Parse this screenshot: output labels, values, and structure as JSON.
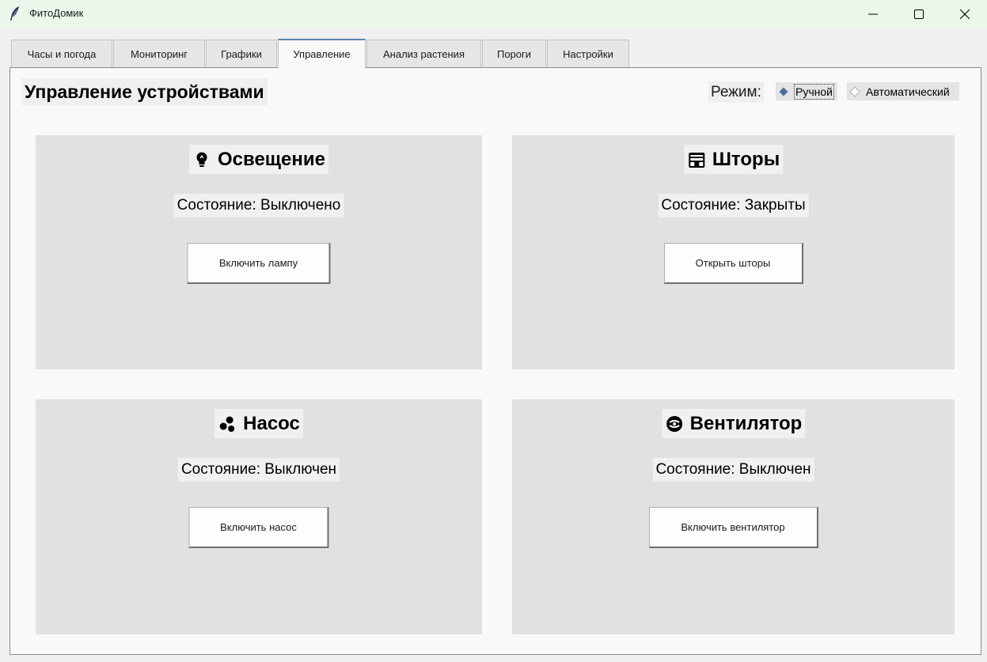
{
  "window": {
    "title": "ФитоДомик",
    "icon": "feather-icon",
    "controls": [
      "minimize-icon",
      "maximize-icon",
      "close-icon"
    ]
  },
  "tabs": [
    {
      "label": "Часы и погода",
      "active": false
    },
    {
      "label": "Мониторинг",
      "active": false
    },
    {
      "label": "Графики",
      "active": false
    },
    {
      "label": "Управление",
      "active": true
    },
    {
      "label": "Анализ растения",
      "active": false
    },
    {
      "label": "Пороги",
      "active": false
    },
    {
      "label": "Настройки",
      "active": false
    }
  ],
  "header": {
    "title": "Управление устройствами",
    "mode_label": "Режим:",
    "mode_options": [
      {
        "label": "Ручной",
        "selected": true
      },
      {
        "label": "Автоматический",
        "selected": false
      }
    ]
  },
  "devices": [
    {
      "title": "Освещение",
      "icon": "lightbulb-icon",
      "status": "Состояние: Выключено",
      "button": "Включить лампу"
    },
    {
      "title": "Шторы",
      "icon": "curtains-icon",
      "status": "Состояние: Закрыты",
      "button": "Открыть шторы"
    },
    {
      "title": "Насос",
      "icon": "water-drops-icon",
      "status": "Состояние: Выключен",
      "button": "Включить насос"
    },
    {
      "title": "Вентилятор",
      "icon": "fan-icon",
      "status": "Состояние: Выключен",
      "button": "Включить вентилятор"
    }
  ],
  "colors": {
    "titlebar_bg": "#eaf7ea",
    "active_tab_accent": "#5d83b0",
    "panel_bg": "#e1e1e1",
    "radio_selected": "#4a6d9a"
  }
}
